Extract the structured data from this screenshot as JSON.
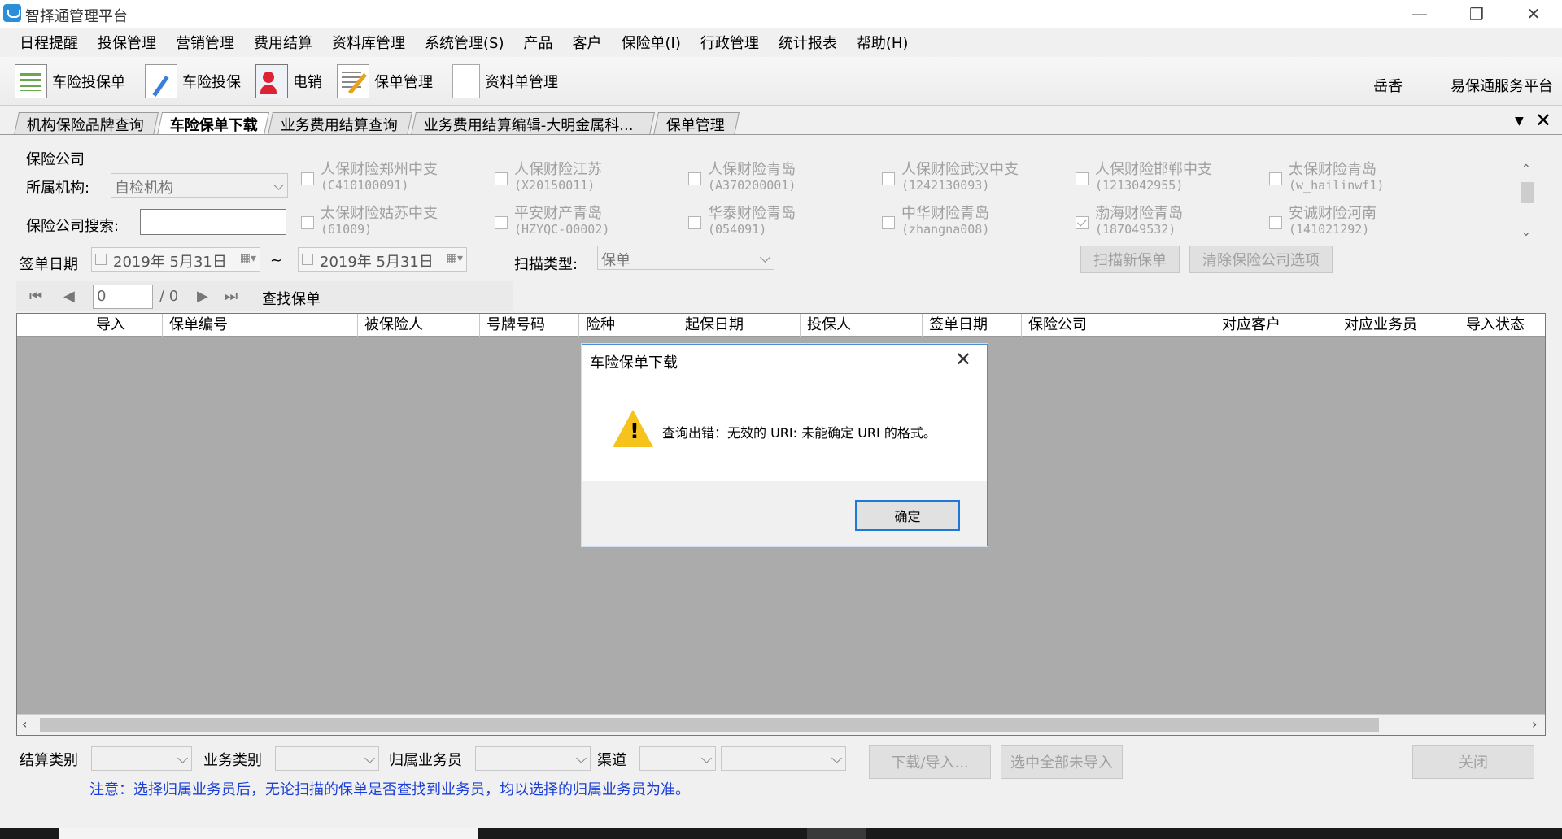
{
  "app": {
    "title": "智择通管理平台",
    "window_controls": {
      "minimize": "—",
      "restore": "❐",
      "close": "✕"
    }
  },
  "menu": [
    "日程提醒",
    "投保管理",
    "营销管理",
    "费用结算",
    "资料库管理",
    "系统管理(S)",
    "产品",
    "客户",
    "保险单(I)",
    "行政管理",
    "统计报表",
    "帮助(H)"
  ],
  "toolbar": {
    "buttons": [
      {
        "label": "车险投保单",
        "icon": "spreadsheet-icon"
      },
      {
        "label": "车险投保",
        "icon": "document-pen-icon"
      },
      {
        "label": "电销",
        "icon": "contact-card-icon"
      },
      {
        "label": "保单管理",
        "icon": "edit-list-icon"
      },
      {
        "label": "资料单管理",
        "icon": "blank-document-icon"
      }
    ],
    "user": "岳香",
    "service_platform": "易保通服务平台"
  },
  "tabs": [
    "机构保险品牌查询",
    "车险保单下载",
    "业务费用结算查询",
    "业务费用结算编辑-大明金属科...",
    "保单管理"
  ],
  "active_tab": 1,
  "filter": {
    "group_label": "保险公司",
    "org_label": "所属机构:",
    "org_value": "自检机构",
    "company_search_label": "保险公司搜索:",
    "company_search_value": "",
    "companies": [
      {
        "name": "人保财险郑州中支",
        "code": "(C410100091)",
        "checked": false
      },
      {
        "name": "人保财险江苏",
        "code": "(X20150011)",
        "checked": false
      },
      {
        "name": "人保财险青岛",
        "code": "(A370200001)",
        "checked": false
      },
      {
        "name": "人保财险武汉中支",
        "code": "(1242130093)",
        "checked": false
      },
      {
        "name": "人保财险邯郸中支",
        "code": "(1213042955)",
        "checked": false
      },
      {
        "name": "太保财险青岛",
        "code": "(w_hailinwf1)",
        "checked": false
      },
      {
        "name": "太保财险姑苏中支",
        "code": "(61009)",
        "checked": false
      },
      {
        "name": "平安财产青岛",
        "code": "(HZYQC-00002)",
        "checked": false
      },
      {
        "name": "华泰财险青岛",
        "code": "(054091)",
        "checked": false
      },
      {
        "name": "中华财险青岛",
        "code": "(zhangna008)",
        "checked": false
      },
      {
        "name": "渤海财险青岛",
        "code": "(187049532)",
        "checked": true
      },
      {
        "name": "安诚财险河南",
        "code": "(141021292)",
        "checked": false
      }
    ],
    "sign_date_label": "签单日期",
    "date_from": "2019年  5月31日",
    "date_to": "2019年  5月31日",
    "tilde": "~",
    "scan_type_label": "扫描类型:",
    "scan_type_value": "保单",
    "scan_new_button": "扫描新保单",
    "clear_companies_button": "清除保险公司选项"
  },
  "navigator": {
    "position": "0",
    "total": "/ 0",
    "find_label": "查找保单"
  },
  "grid": {
    "columns": [
      "",
      "导入",
      "保单编号",
      "被保险人",
      "号牌号码",
      "险种",
      "起保日期",
      "投保人",
      "签单日期",
      "保险公司",
      "对应客户",
      "对应业务员",
      "导入状态"
    ]
  },
  "bottom": {
    "settlement_type_label": "结算类别",
    "business_type_label": "业务类别",
    "salesman_label": "归属业务员",
    "channel_label": "渠道",
    "download_import_button": "下载/导入...",
    "select_all_not_imported_button": "选中全部未导入",
    "close_button": "关闭",
    "note": "注意：选择归属业务员后，无论扫描的保单是否查找到业务员，均以选择的归属业务员为准。"
  },
  "dialog": {
    "title": "车险保单下载",
    "message": "查询出错：无效的 URI: 未能确定 URI 的格式。",
    "ok_button": "确定",
    "warning_mark": "!"
  }
}
